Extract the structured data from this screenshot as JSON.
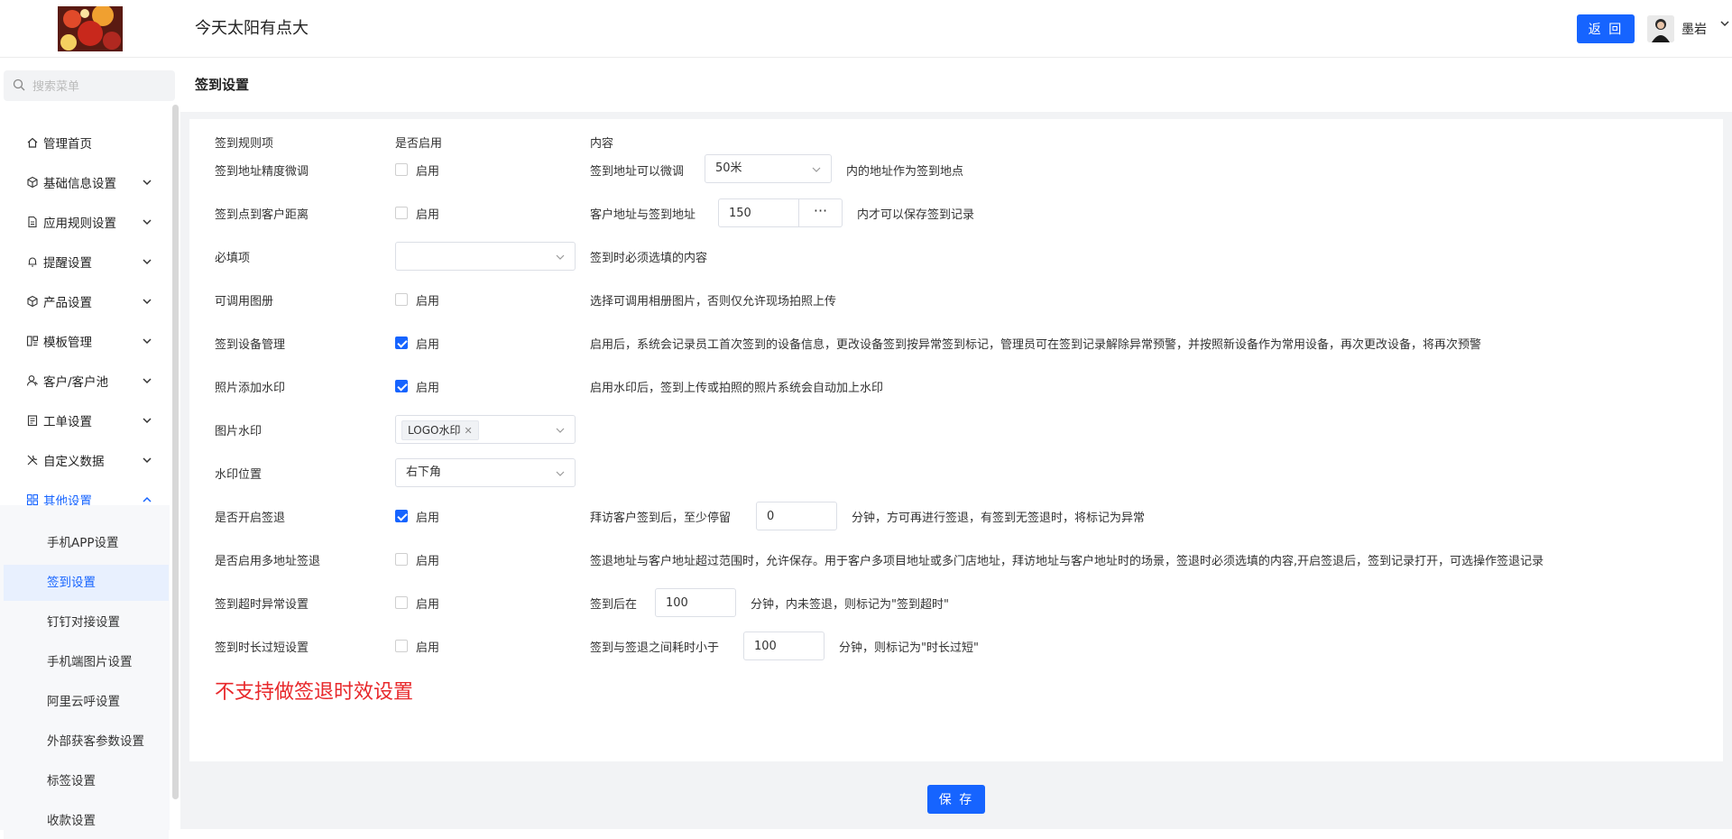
{
  "header": {
    "title": "今天太阳有点大",
    "back_label": "返 回",
    "user_name": "墨岩"
  },
  "sidebar": {
    "search_placeholder": "搜索菜单",
    "items": [
      {
        "label": "管理首页",
        "icon": "home-icon"
      },
      {
        "label": "基础信息设置",
        "icon": "cube-icon"
      },
      {
        "label": "应用规则设置",
        "icon": "document-icon"
      },
      {
        "label": "提醒设置",
        "icon": "bell-icon"
      },
      {
        "label": "产品设置",
        "icon": "cube-icon"
      },
      {
        "label": "模板管理",
        "icon": "template-icon"
      },
      {
        "label": "客户/客户池",
        "icon": "user-icon"
      },
      {
        "label": "工单设置",
        "icon": "clipboard-icon"
      },
      {
        "label": "自定义数据",
        "icon": "tools-icon"
      },
      {
        "label": "其他设置",
        "icon": "grid-icon"
      }
    ],
    "sub_items": [
      "手机APP设置",
      "签到设置",
      "钉钉对接设置",
      "手机端图片设置",
      "阿里云呼设置",
      "外部获客参数设置",
      "标签设置",
      "收款设置"
    ],
    "active_sub": "签到设置"
  },
  "page": {
    "title": "签到设置",
    "columns": {
      "rule": "签到规则项",
      "enabled": "是否启用",
      "content": "内容"
    },
    "enable_label": "启用",
    "rows": {
      "precision": {
        "label": "签到地址精度微调",
        "checked": false,
        "text1": "签到地址可以微调",
        "select": "50米",
        "text2": "内的地址作为签到地点"
      },
      "distance": {
        "label": "签到点到客户距离",
        "checked": false,
        "text1": "客户地址与签到地址",
        "value": "150",
        "dots": "···",
        "text2": "内才可以保存签到记录"
      },
      "required": {
        "label": "必填项",
        "select": "",
        "text": "签到时必须选填的内容"
      },
      "album": {
        "label": "可调用图册",
        "checked": false,
        "text": "选择可调用相册图片，否则仅允许现场拍照上传"
      },
      "device": {
        "label": "签到设备管理",
        "checked": true,
        "text": "启用后，系统会记录员工首次签到的设备信息，更改设备签到按异常签到标记，管理员可在签到记录解除异常预警，并按照新设备作为常用设备，再次更改设备，将再次预警"
      },
      "watermark": {
        "label": "照片添加水印",
        "checked": true,
        "text": "启用水印后，签到上传或拍照的照片系统会自动加上水印"
      },
      "image_wm": {
        "label": "图片水印",
        "tag": "LOGO水印"
      },
      "wm_position": {
        "label": "水印位置",
        "select": "右下角"
      },
      "checkout": {
        "label": "是否开启签退",
        "checked": true,
        "text1": "拜访客户签到后，至少停留",
        "value": "0",
        "text2": "分钟，方可再进行签退，有签到无签退时，将标记为异常"
      },
      "multi_addr": {
        "label": "是否启用多地址签退",
        "checked": false,
        "text": "签退地址与客户地址超过范围时，允许保存。用于客户多项目地址或多门店地址，拜访地址与客户地址时的场景，签退时必须选填的内容,开启签退后，签到记录打开，可选操作签退记录"
      },
      "timeout": {
        "label": "签到超时异常设置",
        "checked": false,
        "text1": "签到后在",
        "value": "100",
        "text2": "分钟，内未签退，则标记为\"签到超时\""
      },
      "short": {
        "label": "签到时长过短设置",
        "checked": false,
        "text1": "签到与签退之间耗时小于",
        "value": "100",
        "text2": "分钟，则标记为\"时长过短\""
      }
    },
    "note": "不支持做签退时效设置",
    "save_label": "保 存"
  },
  "colors": {
    "primary": "#1664ff",
    "note_red": "#e8282b"
  }
}
